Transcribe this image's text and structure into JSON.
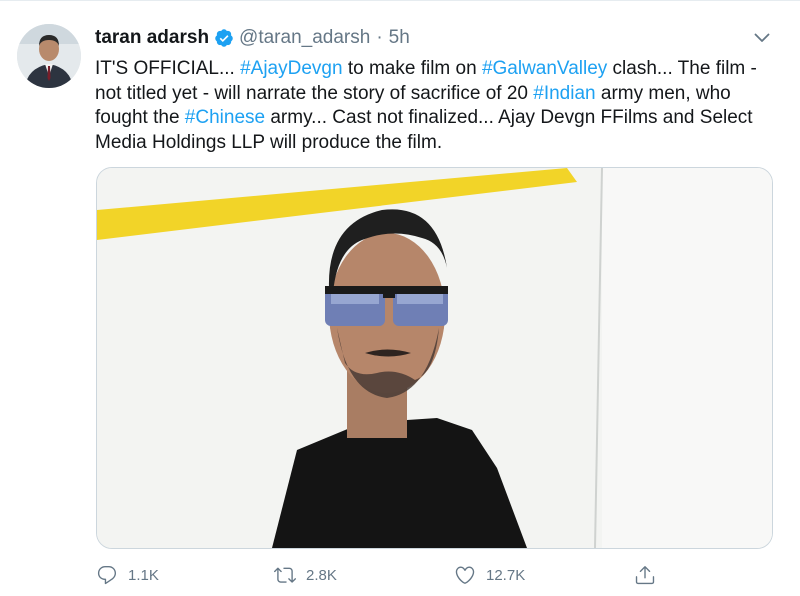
{
  "tweet": {
    "author": {
      "display_name": "taran adarsh",
      "handle": "@taran_adarsh",
      "verified": true
    },
    "separator": "·",
    "time": "5h",
    "text_lines": [
      [
        {
          "t": "IT'S OFFICIAL... ",
          "tag": false
        },
        {
          "t": "#AjayDevgn",
          "tag": true
        },
        {
          "t": " to make film on ",
          "tag": false
        },
        {
          "t": "#GalwanValley",
          "tag": true
        },
        {
          "t": " clash... The film -",
          "tag": false
        }
      ],
      [
        {
          "t": "not titled yet - will narrate the story of sacrifice of 20 ",
          "tag": false
        },
        {
          "t": "#Indian",
          "tag": true
        },
        {
          "t": " army men, who",
          "tag": false
        }
      ],
      [
        {
          "t": "fought the ",
          "tag": false
        },
        {
          "t": "#Chinese",
          "tag": true
        },
        {
          "t": " army... Cast not finalized... Ajay Devgn FFilms and Select",
          "tag": false
        }
      ],
      [
        {
          "t": "Media Holdings LLP will produce the film.",
          "tag": false
        }
      ]
    ],
    "actions": {
      "reply": {
        "icon": "reply-icon",
        "count": "1.1K"
      },
      "retweet": {
        "icon": "retweet-icon",
        "count": "2.8K"
      },
      "like": {
        "icon": "heart-icon",
        "count": "12.7K"
      },
      "share": {
        "icon": "share-icon"
      }
    }
  },
  "colors": {
    "hashtag": "#1da1f2",
    "verified_badge": "#1da1f2",
    "muted_text": "#657786",
    "text": "#14171a"
  }
}
